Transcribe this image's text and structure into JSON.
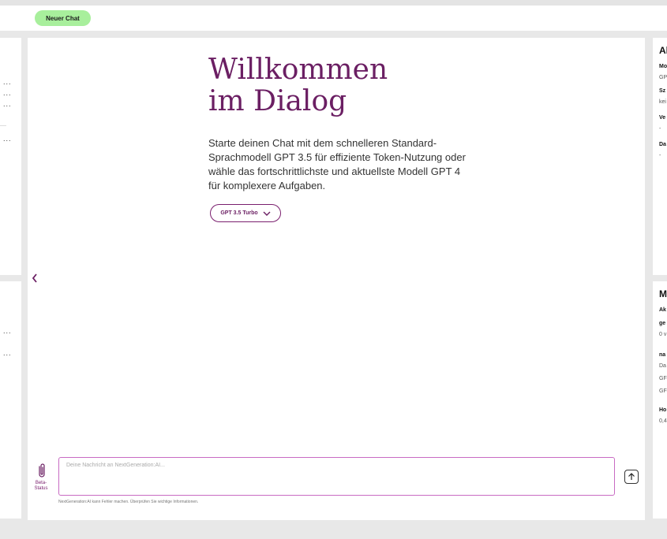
{
  "header": {
    "new_chat_label": "Neuer Chat"
  },
  "main": {
    "welcome_line1": "Willkommen",
    "welcome_line2": "im Dialog",
    "intro_text": "Starte deinen Chat mit dem schnelleren Standard-Sprachmodell GPT 3.5 für effiziente Token-Nutzung oder wähle das fortschrittlichste und aktuellste Modell GPT 4 für komplexere Aufgaben.",
    "model_selected": "GPT 3.5 Turbo"
  },
  "composer": {
    "placeholder": "Deine Nachricht an NextGeneration:AI...",
    "beta_label_1": "Beta-",
    "beta_label_2": "Status",
    "disclaimer": "NextGeneration:AI kann Fehler machen. Überprüfen Sie wichtige Informationen."
  },
  "left_panel": {
    "top_dots": [
      "...",
      "...",
      "...",
      "..."
    ],
    "bottom_dots": [
      "...",
      "..."
    ]
  },
  "right_top": {
    "title": "Al",
    "rows": [
      {
        "label": "Mo",
        "value": "GP"
      },
      {
        "label": "Sz",
        "value": "kei"
      },
      {
        "label": "Ve",
        "value": "-"
      },
      {
        "label": "Da",
        "value": "-"
      }
    ]
  },
  "right_bottom": {
    "title": "M",
    "ak": "Ak",
    "ge": "ge",
    "ge_value": "0 v",
    "na": "na",
    "na_values": [
      "Da",
      "GF",
      "GF"
    ],
    "ho": "Ho",
    "ho_value": "0,4"
  },
  "colors": {
    "accent": "#6b1f63",
    "new_chat_bg": "#a8ef9c",
    "input_border": "#c86bc3"
  }
}
